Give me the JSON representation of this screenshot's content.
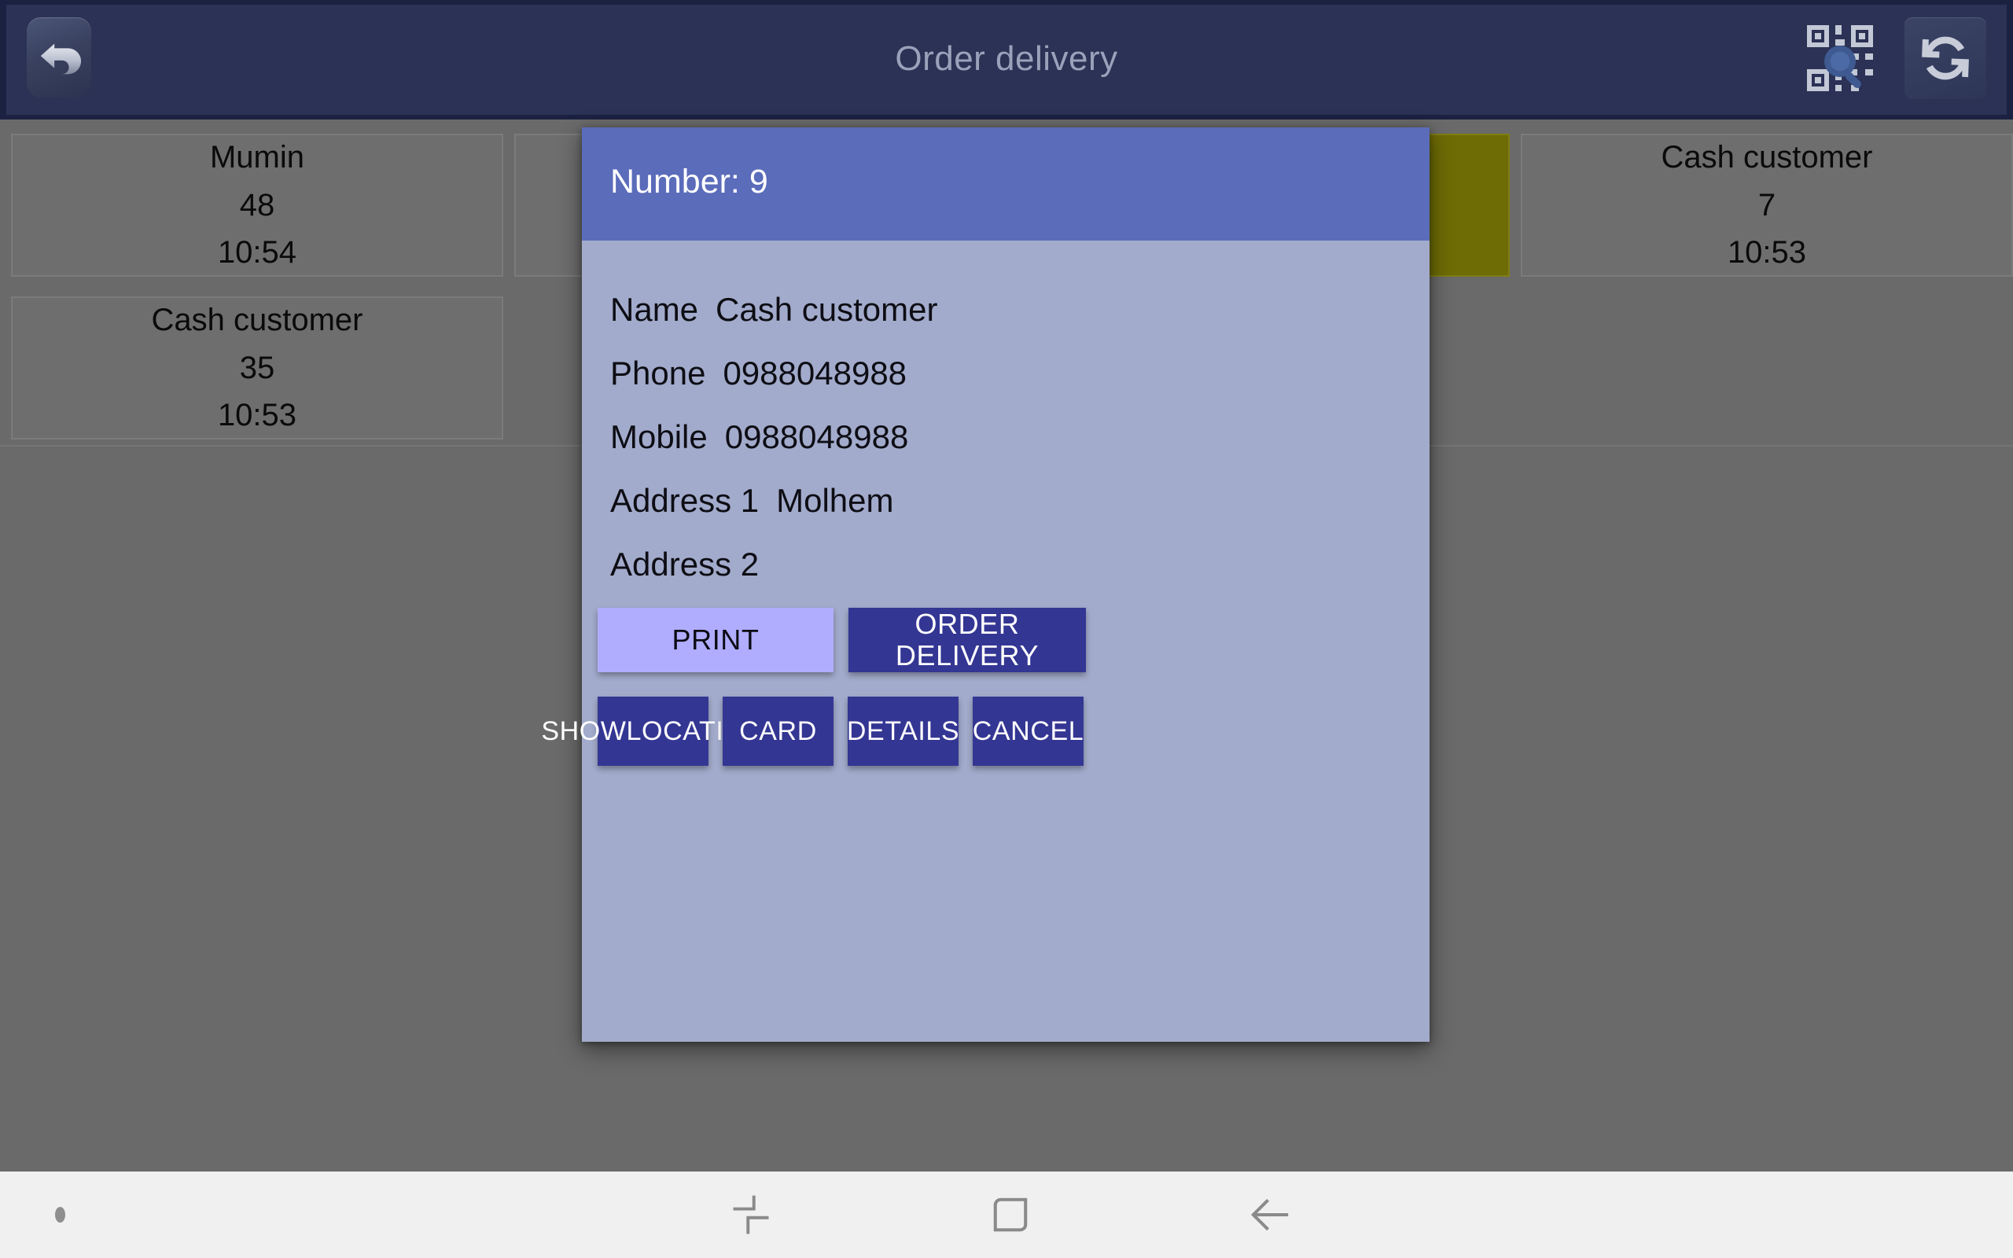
{
  "titlebar": {
    "title": "Order delivery",
    "back_icon": "back-arrow-icon",
    "scan_icon": "qr-scan-search-icon",
    "refresh_icon": "refresh-sync-icon"
  },
  "order_list": {
    "rows": [
      [
        {
          "name": "Mumin",
          "number": "48",
          "time": "10:54",
          "highlight": "none"
        },
        {
          "name": "",
          "number": "",
          "time": "",
          "highlight": "none"
        },
        {
          "name": "",
          "number": "",
          "time": "",
          "highlight": "olive"
        },
        {
          "name": "Cash customer",
          "number": "7",
          "time": "10:53",
          "highlight": "none"
        }
      ],
      [
        {
          "name": "Cash customer",
          "number": "35",
          "time": "10:53",
          "highlight": "none"
        }
      ]
    ]
  },
  "dialog": {
    "title": "Number: 9",
    "fields": [
      {
        "label": "Name",
        "value": "Cash customer"
      },
      {
        "label": "Phone",
        "value": "0988048988"
      },
      {
        "label": "Mobile",
        "value": "0988048988"
      },
      {
        "label": "Address 1",
        "value": "Molhem"
      },
      {
        "label": "Address 2",
        "value": ""
      }
    ],
    "buttons": {
      "print": "PRINT",
      "order_delivery": "ORDER DELIVERY",
      "show_location": "SHOW\nLOCATION",
      "card": "CARD",
      "details": "DETAILS",
      "cancel": "CANCEL"
    }
  },
  "navbar": {
    "recent_icon": "recent-apps-icon",
    "home_icon": "home-square-icon",
    "back_icon": "nav-back-arrow-icon"
  },
  "colors": {
    "titlebar": "#2b3255",
    "titlebar_border": "#1b2141",
    "background": "#6a6a6a",
    "dialog_body": "#a2abcb",
    "dialog_header": "#5b6cba",
    "button_dark": "#343693",
    "button_light": "#b0adff",
    "card": "#6e6e6e",
    "card_olive": "#6e6c05",
    "navbar": "#f0f0f0"
  }
}
